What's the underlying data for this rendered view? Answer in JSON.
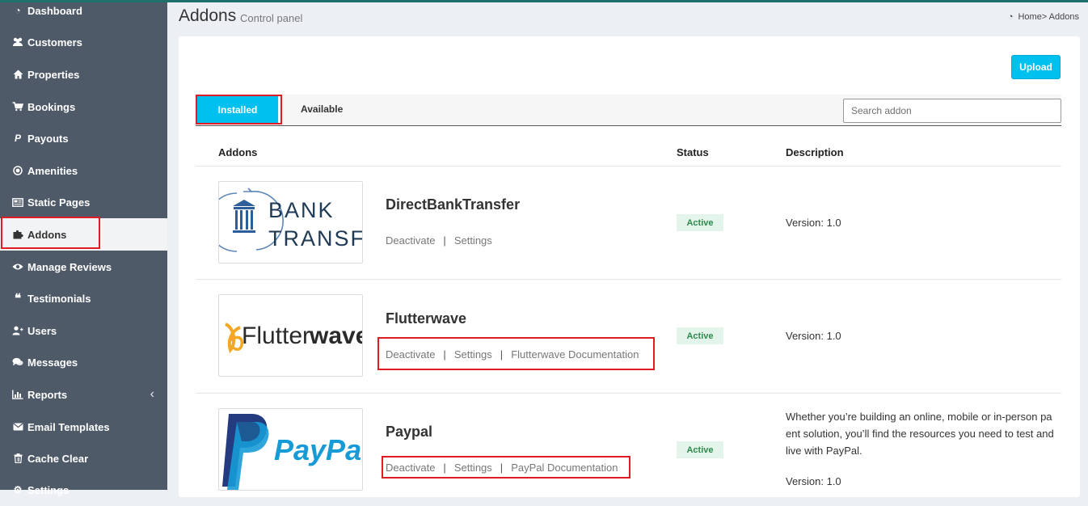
{
  "sidebar": {
    "items": [
      {
        "label": "Dashboard",
        "icon": "dashboard-icon"
      },
      {
        "label": "Customers",
        "icon": "users-icon"
      },
      {
        "label": "Properties",
        "icon": "home-icon"
      },
      {
        "label": "Bookings",
        "icon": "cart-icon"
      },
      {
        "label": "Payouts",
        "icon": "paypal-icon"
      },
      {
        "label": "Amenities",
        "icon": "circle-dot-icon"
      },
      {
        "label": "Static Pages",
        "icon": "newspaper-icon"
      },
      {
        "label": "Addons",
        "icon": "puzzle-icon",
        "active": true
      },
      {
        "label": "Manage Reviews",
        "icon": "eye-icon"
      },
      {
        "label": "Testimonials",
        "icon": "quote-icon"
      },
      {
        "label": "Users",
        "icon": "user-plus-icon"
      },
      {
        "label": "Messages",
        "icon": "comments-icon"
      },
      {
        "label": "Reports",
        "icon": "bar-chart-icon",
        "chevron": "‹"
      },
      {
        "label": "Email Templates",
        "icon": "envelope-icon"
      },
      {
        "label": "Cache Clear",
        "icon": "trash-icon"
      },
      {
        "label": "Settings",
        "icon": "gear-icon"
      }
    ]
  },
  "header": {
    "title": "Addons",
    "subtitle": "Control panel",
    "breadcrumb": "Home> Addons"
  },
  "toolbar": {
    "upload_label": "Upload"
  },
  "tabs": {
    "installed": "Installed",
    "available": "Available"
  },
  "search": {
    "placeholder": "Search addon"
  },
  "table": {
    "headers": {
      "addons": "Addons",
      "status": "Status",
      "description": "Description"
    },
    "rows": [
      {
        "name": "DirectBankTransfer",
        "logo_text": [
          "BANK",
          "TRANSFER"
        ],
        "links": [
          "Deactivate",
          "Settings"
        ],
        "status": "Active",
        "description": [],
        "version": "Version: 1.0"
      },
      {
        "name": "Flutterwave",
        "logo_text": [
          "Flutter",
          "wave"
        ],
        "links": [
          "Deactivate",
          "Settings",
          "Flutterwave Documentation"
        ],
        "status": "Active",
        "description": [],
        "version": "Version: 1.0"
      },
      {
        "name": "Paypal",
        "logo_text": [
          "PayPal"
        ],
        "links": [
          "Deactivate",
          "Settings",
          "PayPal Documentation"
        ],
        "status": "Active",
        "description": [
          "Whether you’re building an online, mobile or in-person pa",
          "ent solution, you’ll find the resources you need to test and",
          "live with PayPal."
        ],
        "version": "Version: 1.0"
      }
    ]
  },
  "colors": {
    "sidebar_bg": "#4f5a68",
    "accent": "#00c0ef",
    "highlight": "#e01b24",
    "status_bg": "#e3f5ea",
    "status_text": "#2e8a4e"
  }
}
